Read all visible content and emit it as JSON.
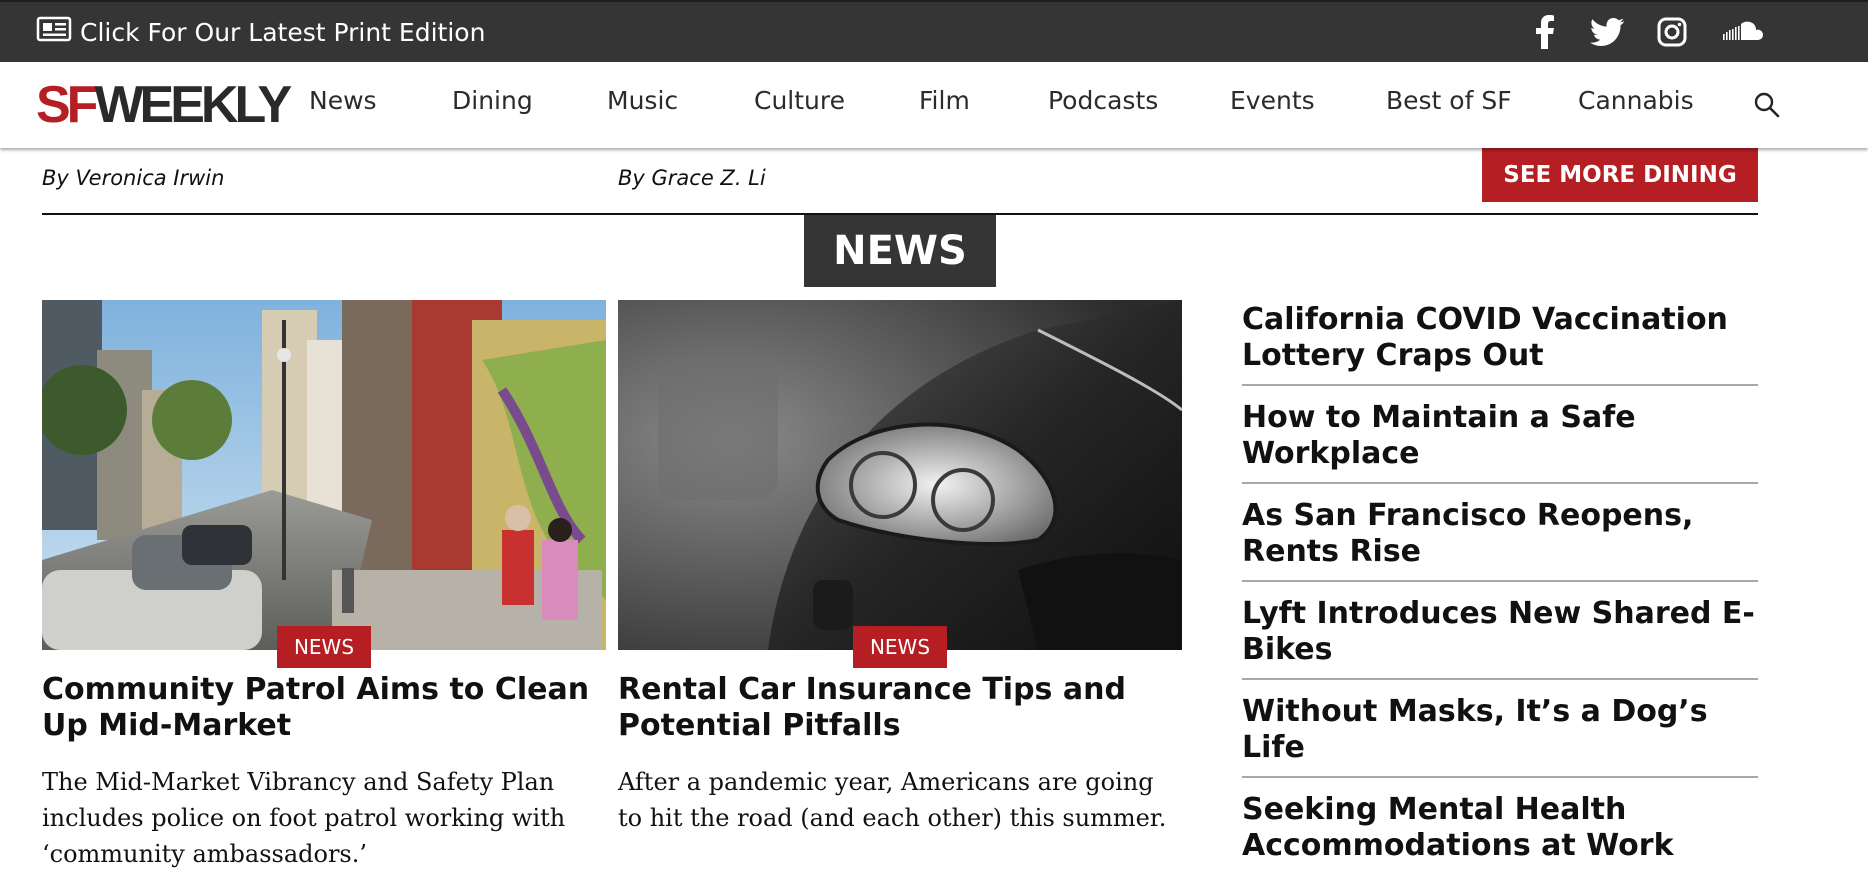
{
  "topbar": {
    "print_label": "Click For Our Latest Print Edition",
    "social": [
      "facebook-icon",
      "twitter-icon",
      "instagram-icon",
      "soundcloud-icon"
    ]
  },
  "nav": {
    "logo_sf": "SF",
    "logo_weekly": "WEEKLY",
    "items": [
      "News",
      "Dining",
      "Music",
      "Culture",
      "Film",
      "Podcasts",
      "Events",
      "Best of SF",
      "Cannabis"
    ]
  },
  "prev_section": {
    "byline_1": "By Veronica Irwin",
    "byline_2": "By Grace Z. Li",
    "see_more": "SEE MORE DINING"
  },
  "section": {
    "title": "NEWS"
  },
  "cards": [
    {
      "tag": "NEWS",
      "title": "Community Patrol Aims to Clean Up Mid-Market",
      "description": "The Mid-Market Vibrancy and Safety Plan includes police on foot patrol working with ‘community ambassadors.’"
    },
    {
      "tag": "NEWS",
      "title": "Rental Car Insurance Tips and Potential Pitfalls",
      "description": "After a pandemic year, Americans are going to hit the road (and each other) this summer."
    }
  ],
  "sidebar": [
    "California COVID Vaccination Lottery Craps Out",
    "How to Maintain a Safe Workplace",
    "As San Francisco Reopens, Rents Rise",
    "Lyft Introduces New Shared E-Bikes",
    "Without Masks, It’s a Dog’s Life",
    "Seeking Mental Health Accommodations at Work"
  ],
  "colors": {
    "brand_red": "#b51f24",
    "dark_bar": "#353535"
  }
}
